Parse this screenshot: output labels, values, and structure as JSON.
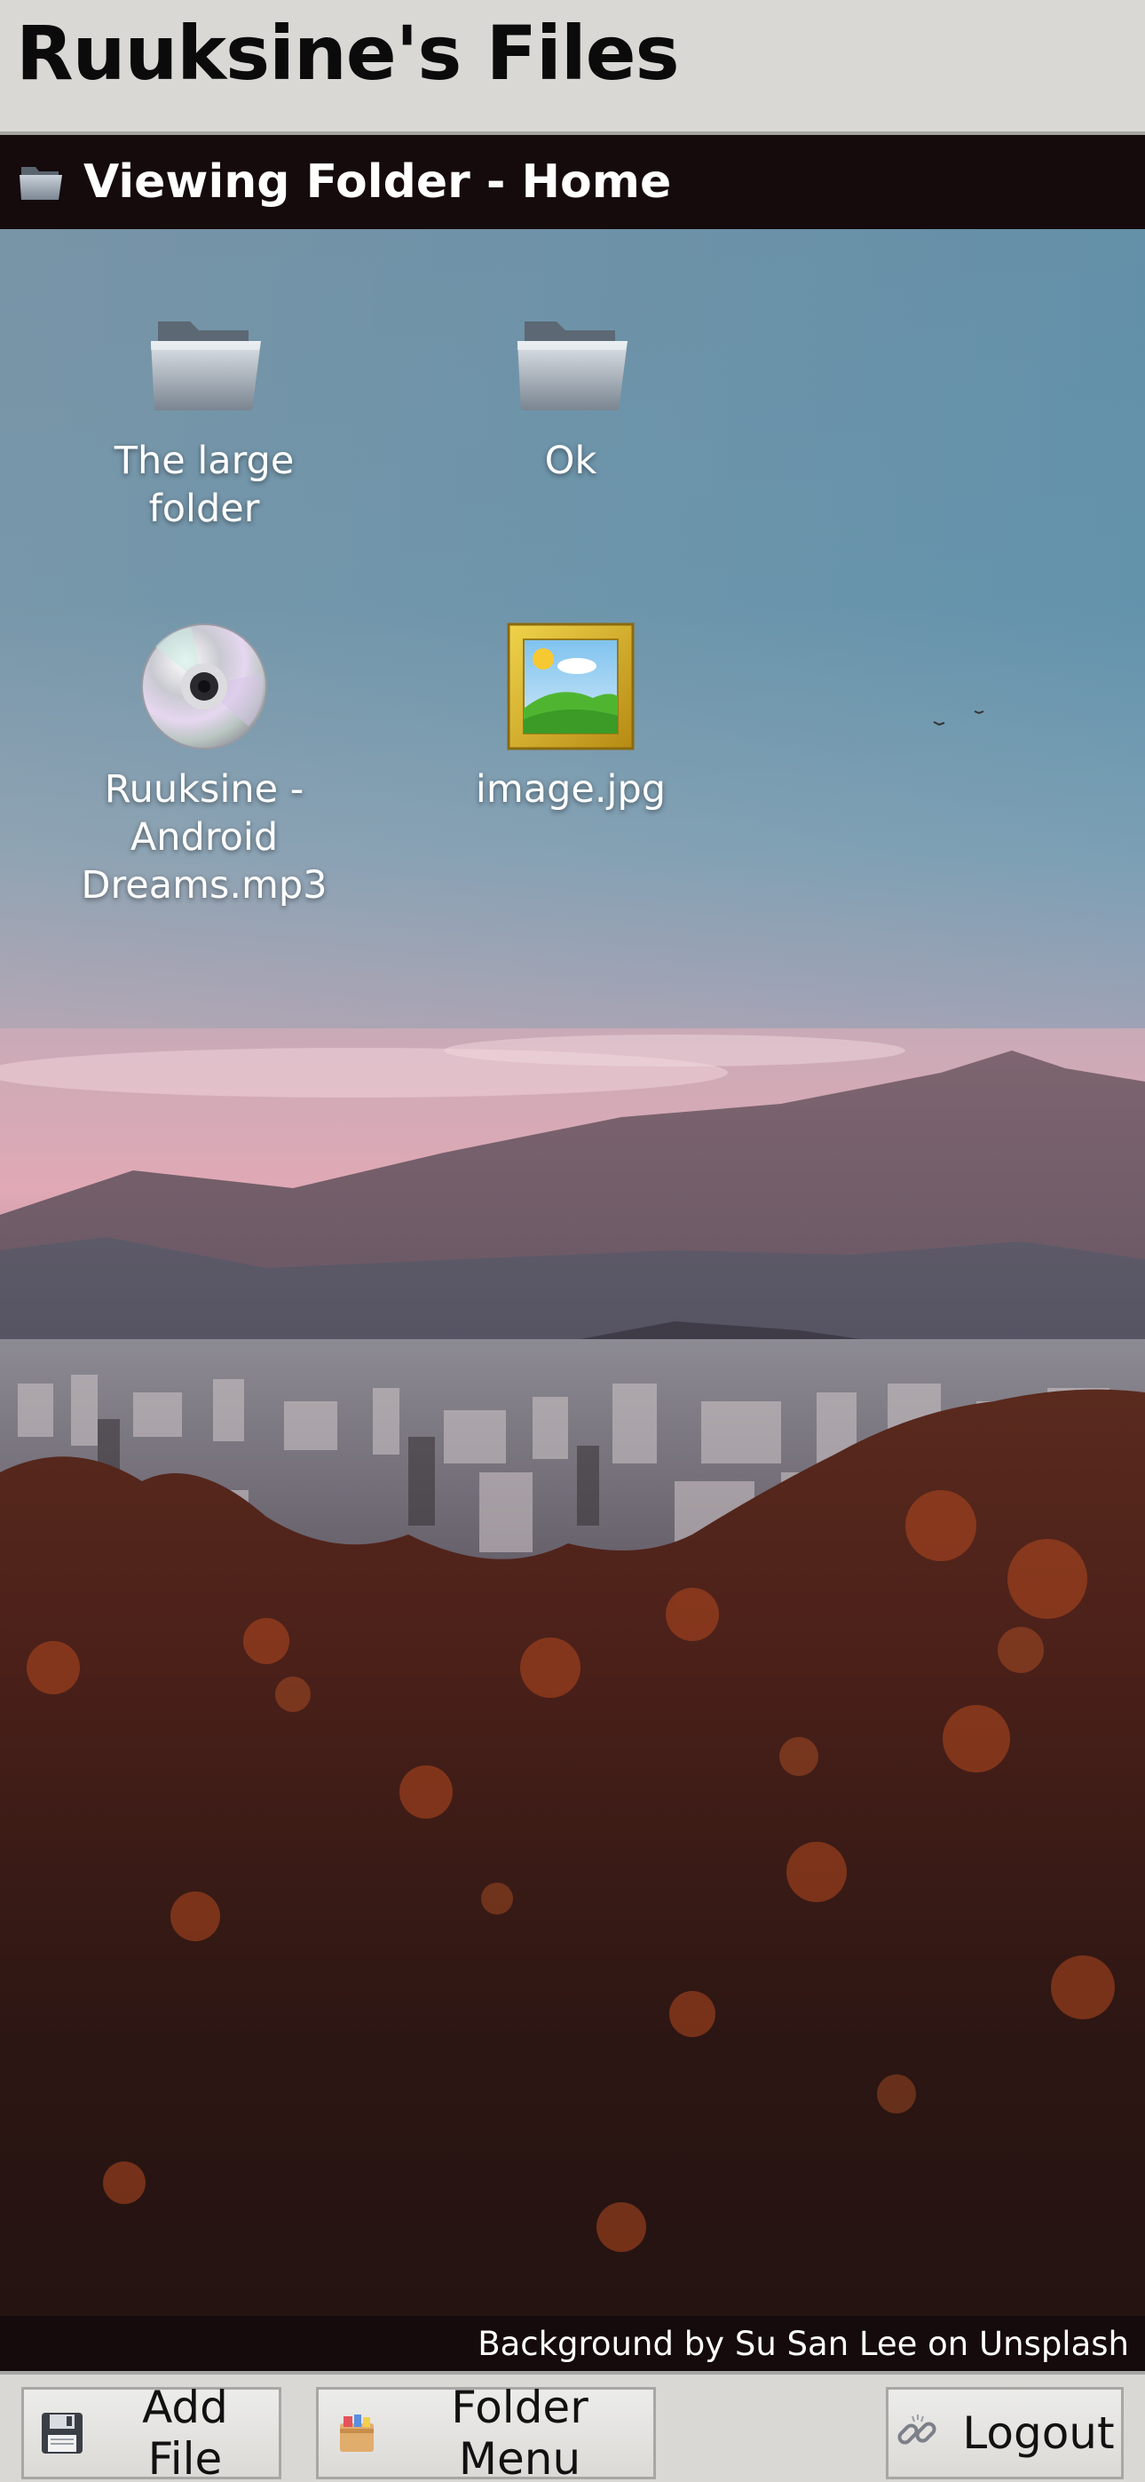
{
  "header": {
    "title": "Ruuksine's Files"
  },
  "folder_bar": {
    "title": "Viewing Folder - Home",
    "icon": "folder-icon"
  },
  "files": [
    {
      "name": "The large folder",
      "type": "folder",
      "icon": "folder-icon"
    },
    {
      "name": "Ok",
      "type": "folder",
      "icon": "folder-icon"
    },
    {
      "name": "Ruuksine - Android Dreams.mp3",
      "type": "audio",
      "icon": "cd-icon"
    },
    {
      "name": "image.jpg",
      "type": "image",
      "icon": "framed-picture-icon"
    }
  ],
  "credit": {
    "text": "Background by Su San Lee on Unsplash"
  },
  "toolbar": {
    "add_file_label": "Add File",
    "add_file_icon": "floppy-disk-icon",
    "folder_menu_label": "Folder Menu",
    "folder_menu_icon": "file-cabinet-icon",
    "logout_label": "Logout",
    "logout_icon": "broken-chain-icon"
  },
  "colors": {
    "header_bg": "#dad8d4",
    "bar_bg": "#150a0c",
    "text_light": "#ffffff",
    "text_dark": "#0b0b0b"
  }
}
